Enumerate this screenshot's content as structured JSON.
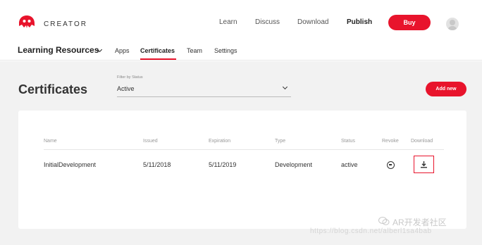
{
  "brand": {
    "name": "CREATOR",
    "color": "#e8142c"
  },
  "topnav": {
    "links": [
      "Learn",
      "Discuss",
      "Download",
      "Publish"
    ],
    "buy_label": "Buy"
  },
  "subnav": {
    "title": "Learning Resources",
    "tabs": [
      "Apps",
      "Certificates",
      "Team",
      "Settings"
    ],
    "active_tab": "Certificates"
  },
  "page": {
    "title": "Certificates",
    "filter": {
      "label": "Filter by Status",
      "value": "Active"
    },
    "add_label": "Add new"
  },
  "table": {
    "headers": [
      "Name",
      "Issued",
      "Expiration",
      "Type",
      "Status",
      "Revoke",
      "Download"
    ],
    "rows": [
      {
        "name": "InitialDevelopment",
        "issued": "5/11/2018",
        "expiration": "5/11/2019",
        "type": "Development",
        "status": "active"
      }
    ]
  },
  "watermark": {
    "brand": "AR开发者社区",
    "url": "https://blog.csdn.net/alberl1sa4bab"
  },
  "icons": [
    "logo-icon",
    "chevron-down-icon",
    "avatar-icon",
    "revoke-icon",
    "download-icon",
    "wechat-icon"
  ]
}
